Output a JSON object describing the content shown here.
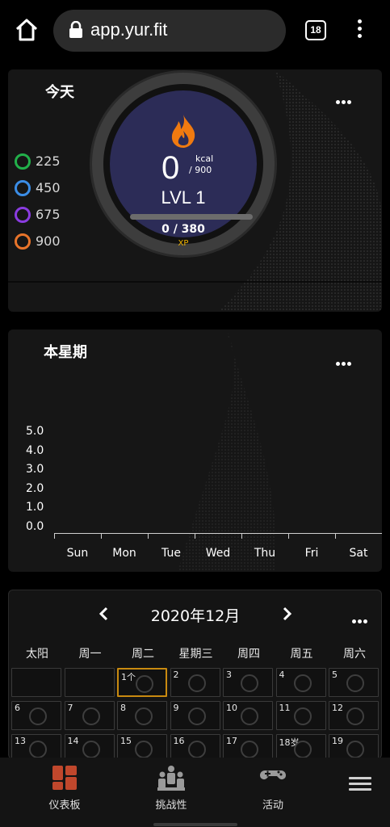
{
  "browser": {
    "url": "app.yur.fit",
    "tab_count": "18"
  },
  "today": {
    "title": "今天",
    "rings": [
      {
        "value": "225",
        "color": "#22b04a"
      },
      {
        "value": "450",
        "color": "#3b8de6"
      },
      {
        "value": "675",
        "color": "#8a3ce0"
      },
      {
        "value": "900",
        "color": "#e8742a"
      }
    ],
    "kcal_value": "0",
    "kcal_unit": "kcal",
    "kcal_goal": "/ 900",
    "level": "LVL 1",
    "xp_text": "0 / 380",
    "xp_label": "XP",
    "xp_progress": 0
  },
  "week": {
    "title": "本星期"
  },
  "chart_data": {
    "type": "bar",
    "categories": [
      "Sun",
      "Mon",
      "Tue",
      "Wed",
      "Thu",
      "Fri",
      "Sat"
    ],
    "values": [
      0,
      0,
      0,
      0,
      0,
      0,
      0
    ],
    "yticks": [
      "5.0",
      "4.0",
      "3.0",
      "2.0",
      "1.0",
      "0.0"
    ],
    "ylim": [
      0,
      5
    ]
  },
  "calendar": {
    "month_title": "2020年12月",
    "weekdays": [
      "太阳",
      "周一",
      "周二",
      "星期三",
      "周四",
      "周五",
      "周六"
    ],
    "rows": [
      [
        "",
        "",
        "1个",
        "2",
        "3",
        "4",
        "5"
      ],
      [
        "6",
        "7",
        "8",
        "9",
        "10",
        "11",
        "12"
      ],
      [
        "13",
        "14",
        "15",
        "16",
        "17",
        "18岁",
        "19"
      ]
    ],
    "today_label": "1个"
  },
  "nav": {
    "dashboard": "仪表板",
    "challenges": "挑战性",
    "activities": "活动",
    "active_color": "#c0472c"
  }
}
